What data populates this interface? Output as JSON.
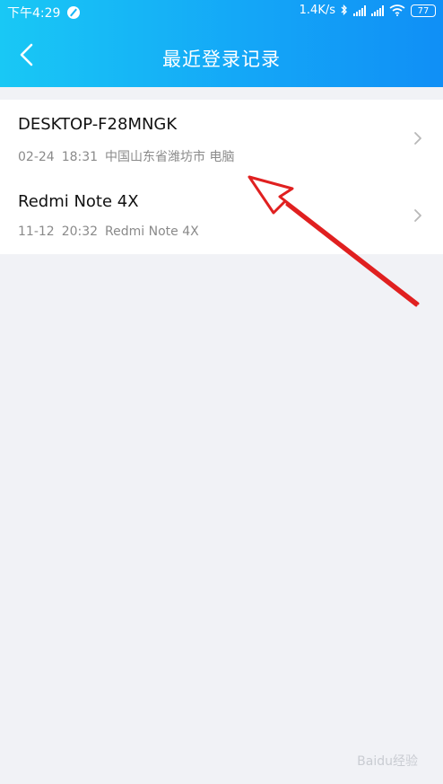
{
  "status_bar": {
    "time": "下午4:29",
    "network_speed": "1.4K/s",
    "battery": "77"
  },
  "header": {
    "title": "最近登录记录",
    "back_icon": "back-arrow-icon"
  },
  "login_records": [
    {
      "device": "DESKTOP-F28MNGK",
      "date": "02-24",
      "time": "18:31",
      "location": "中国山东省潍坊市 电脑"
    },
    {
      "device": "Redmi Note 4X",
      "date": "11-12",
      "time": "20:32",
      "location": "Redmi Note 4X"
    }
  ],
  "watermark": "Baidu经验",
  "colors": {
    "header_start": "#19c8f5",
    "header_end": "#108ff6",
    "annotation_arrow": "#e02020"
  }
}
